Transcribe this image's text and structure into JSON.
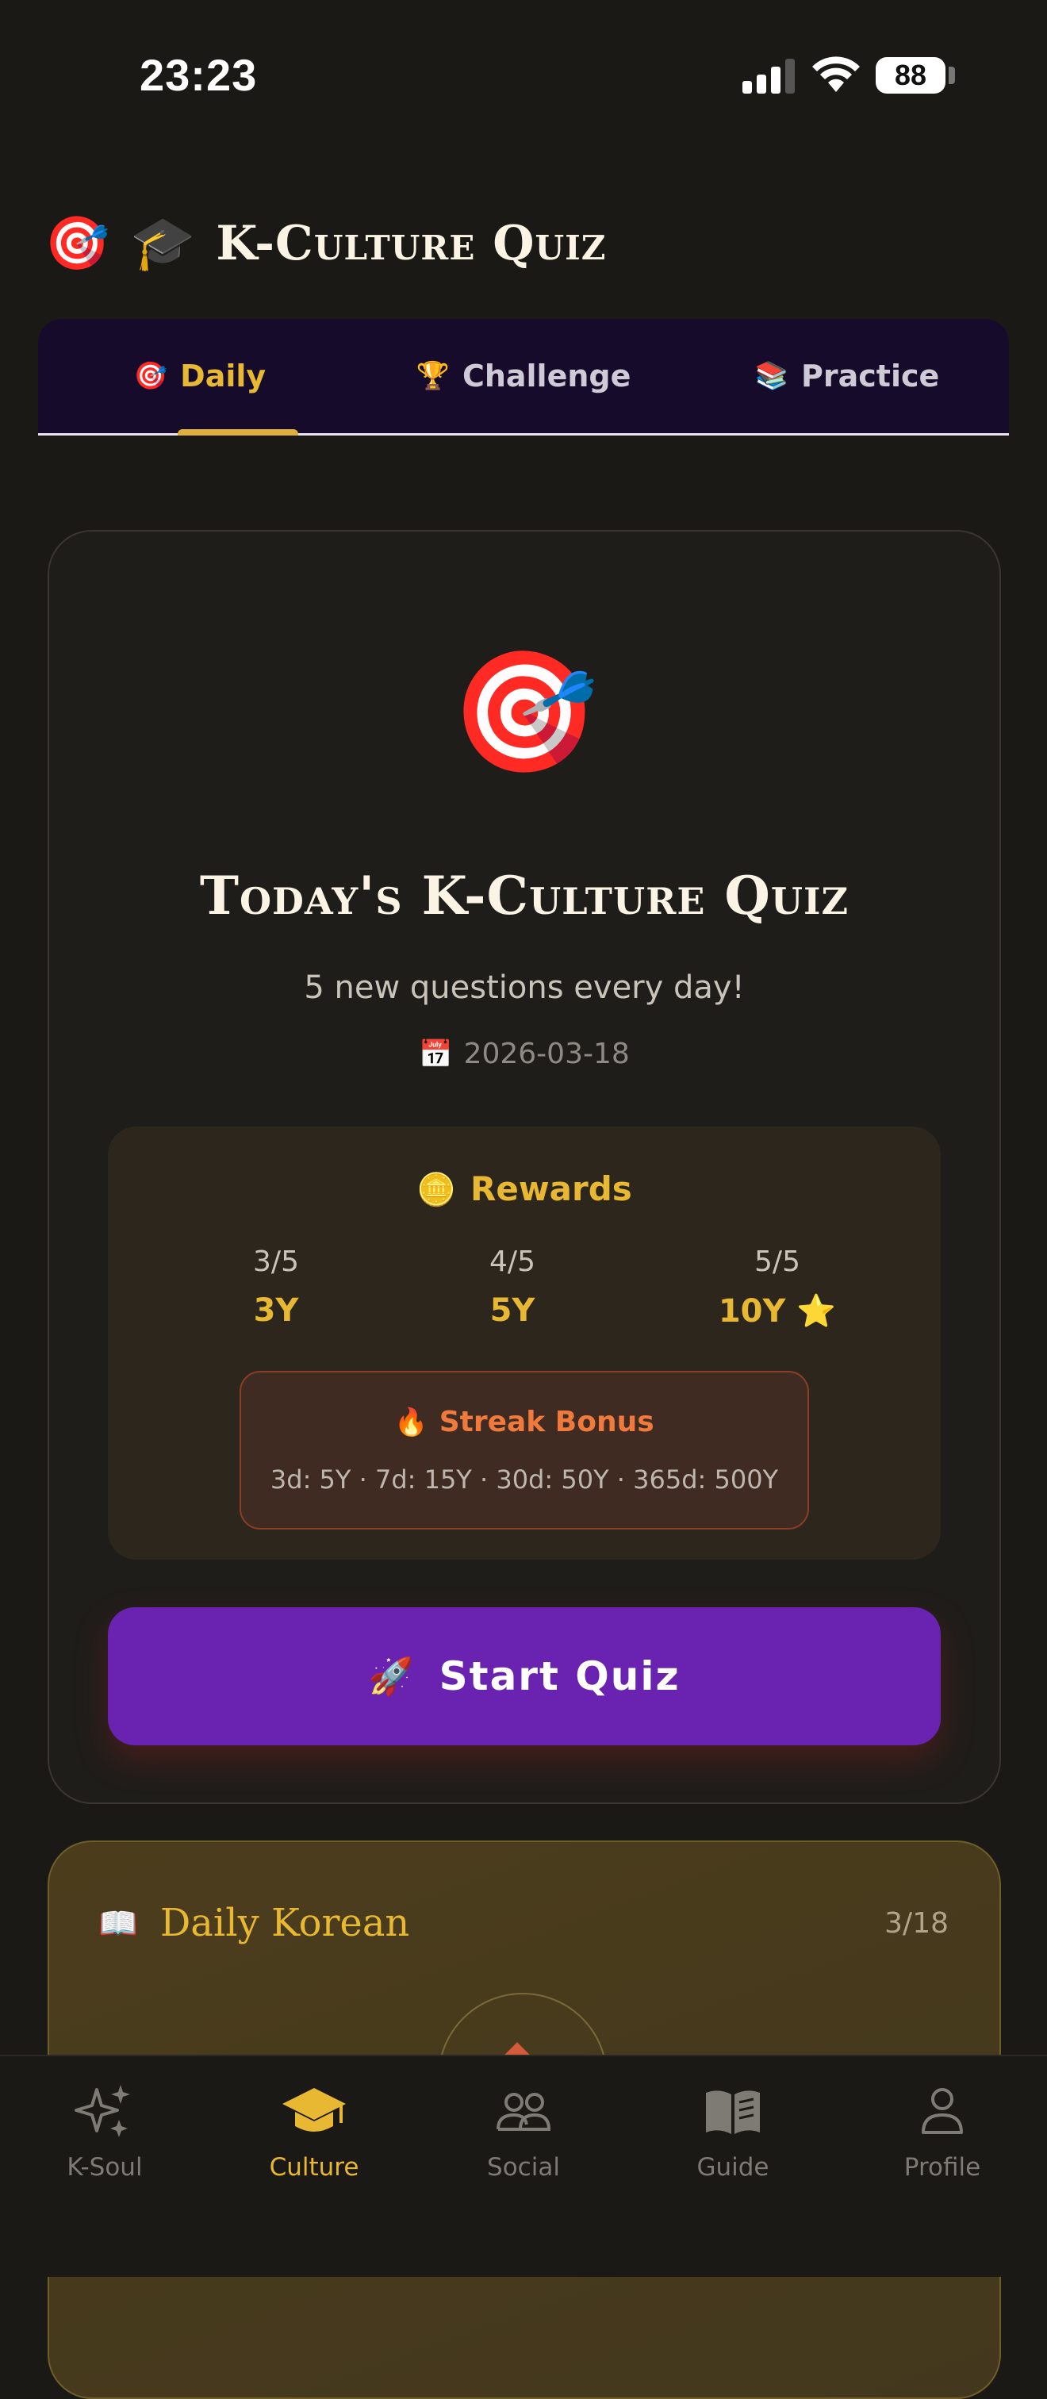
{
  "status_bar": {
    "time": "23:23",
    "battery": "88"
  },
  "header": {
    "emoji": "🎯",
    "title_emoji": "🎓",
    "title": "K-Culture Quiz"
  },
  "tabs": [
    {
      "emoji": "🎯",
      "label": "Daily",
      "active": true
    },
    {
      "emoji": "🏆",
      "label": "Challenge",
      "active": false
    },
    {
      "emoji": "📚",
      "label": "Practice",
      "active": false
    }
  ],
  "quiz_card": {
    "hero_emoji": "🎯",
    "title": "Today's K-Culture Quiz",
    "subtitle": "5 new questions every day!",
    "date_emoji": "📅",
    "date": "2026-03-18",
    "rewards": {
      "emoji": "🪙",
      "title": "Rewards",
      "tiers": [
        {
          "score": "3/5",
          "amount": "3Y"
        },
        {
          "score": "4/5",
          "amount": "5Y"
        },
        {
          "score": "5/5",
          "amount": "10Y ⭐"
        }
      ],
      "streak": {
        "emoji": "🔥",
        "title": "Streak Bonus",
        "text": "3d: 5Y · 7d: 15Y · 30d: 50Y · 365d: 500Y"
      }
    },
    "start_button": {
      "emoji": "🚀",
      "label": "Start Quiz"
    }
  },
  "daily_korean": {
    "emoji": "📖",
    "title": "Daily Korean",
    "date": "3/18"
  },
  "bottom_nav": [
    {
      "icon": "sparkles-icon",
      "label": "K-Soul",
      "active": false
    },
    {
      "icon": "graduation-cap-icon",
      "label": "Culture",
      "active": true
    },
    {
      "icon": "people-icon",
      "label": "Social",
      "active": false
    },
    {
      "icon": "book-icon",
      "label": "Guide",
      "active": false
    },
    {
      "icon": "person-icon",
      "label": "Profile",
      "active": false
    }
  ],
  "colors": {
    "accent": "#e8b833",
    "primary_button": "#6a22b0",
    "streak": "#f07a3c",
    "tab_bg": "#160b2b"
  }
}
